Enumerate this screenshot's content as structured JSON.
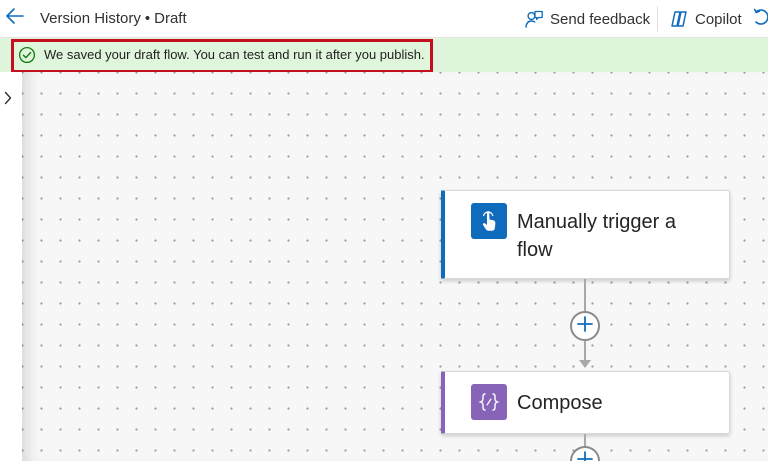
{
  "header": {
    "back_icon": "arrow-left-icon",
    "title": "Version History",
    "separator": "•",
    "status": "Draft",
    "feedback_label": "Send feedback",
    "feedback_icon": "person-feedback-icon",
    "copilot_label": "Copilot",
    "copilot_icon": "copilot-icon",
    "undo_icon": "undo-icon"
  },
  "banner": {
    "message": "We saved your draft flow. You can test and run it after you publish.",
    "icon": "checkmark-circle-icon",
    "background": "#dff6dd",
    "highlight_color": "#c50f1f"
  },
  "sidebar": {
    "expand_icon": "chevron-right-icon"
  },
  "canvas": {
    "nodes": [
      {
        "title": "Manually trigger a flow",
        "icon": "touch-hand-icon",
        "accent": "#0f6cbd"
      },
      {
        "title": "Compose",
        "icon": "curly-braces-icon",
        "accent": "#8764b8"
      }
    ],
    "add_icon": "plus-icon"
  }
}
